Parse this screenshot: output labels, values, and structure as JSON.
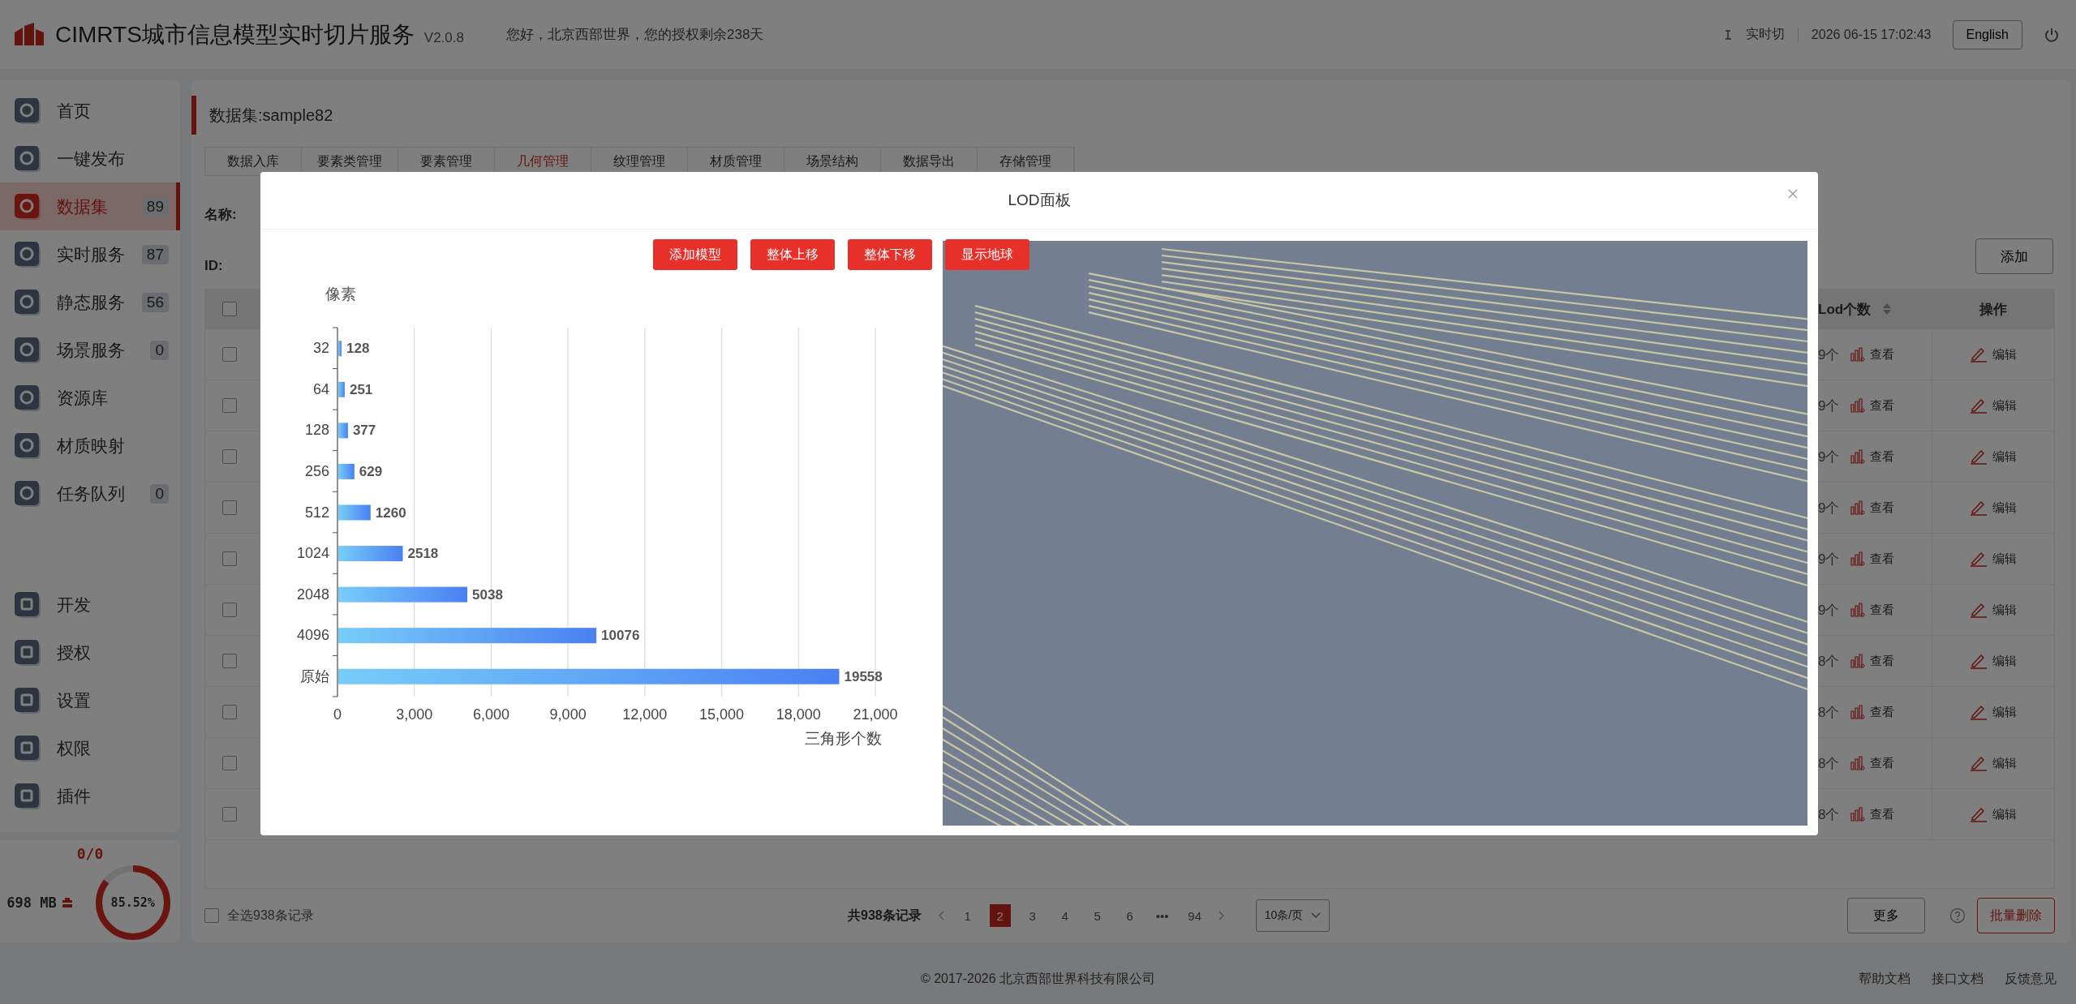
{
  "header": {
    "title": "CIMRTS城市信息模型实时切片服务",
    "version": "V2.0.8",
    "greeting": "您好，北京西部世界，您的授权剩余238天",
    "mode_label": "实时切",
    "datetime": "2026 06-15 17:02:43",
    "language_button": "English"
  },
  "sidebar": {
    "main_items": [
      {
        "label": "首页",
        "selected": false
      },
      {
        "label": "一键发布",
        "selected": false
      },
      {
        "label": "数据集",
        "badge": "89",
        "selected": true
      },
      {
        "label": "实时服务",
        "badge": "87",
        "selected": false
      },
      {
        "label": "静态服务",
        "badge": "56",
        "selected": false
      },
      {
        "label": "场景服务",
        "badge": "0",
        "selected": false
      },
      {
        "label": "资源库",
        "selected": false
      },
      {
        "label": "材质映射",
        "selected": false
      },
      {
        "label": "任务队列",
        "badge": "0",
        "selected": false
      }
    ],
    "system_items": [
      {
        "label": "开发",
        "selected": false
      },
      {
        "label": "授权",
        "selected": false
      },
      {
        "label": "设置",
        "selected": false
      },
      {
        "label": "权限",
        "selected": false
      },
      {
        "label": "插件",
        "selected": false
      }
    ]
  },
  "storage": {
    "ratio": "0/0",
    "size": "698 MB",
    "usage": "85.52%",
    "level": 0.8552
  },
  "dataset_title": "数据集:sample82",
  "tabs": [
    {
      "label": "数据入库",
      "selected": false
    },
    {
      "label": "要素类管理",
      "selected": false
    },
    {
      "label": "要素管理",
      "selected": false
    },
    {
      "label": "几何管理",
      "selected": true
    },
    {
      "label": "纹理管理",
      "selected": false
    },
    {
      "label": "材质管理",
      "selected": false
    },
    {
      "label": "场景结构",
      "selected": false
    },
    {
      "label": "数据导出",
      "selected": false
    },
    {
      "label": "存储管理",
      "selected": false
    }
  ],
  "filters": [
    "名称:",
    "ID:"
  ],
  "add_button": "添加",
  "table": {
    "columns": [
      "Lod个数",
      "操作"
    ],
    "header_checked": false,
    "rows": [
      {
        "lod": "9个",
        "view": "查看",
        "edit": "编辑",
        "checked": false
      },
      {
        "lod": "9个",
        "view": "查看",
        "edit": "编辑",
        "checked": false
      },
      {
        "lod": "9个",
        "view": "查看",
        "edit": "编辑",
        "checked": false
      },
      {
        "lod": "9个",
        "view": "查看",
        "edit": "编辑",
        "checked": false
      },
      {
        "lod": "9个",
        "view": "查看",
        "edit": "编辑",
        "checked": false
      },
      {
        "lod": "9个",
        "view": "查看",
        "edit": "编辑",
        "checked": false
      },
      {
        "lod": "8个",
        "view": "查看",
        "edit": "编辑",
        "checked": false
      },
      {
        "lod": "8个",
        "view": "查看",
        "edit": "编辑",
        "checked": false
      },
      {
        "lod": "8个",
        "view": "查看",
        "edit": "编辑",
        "checked": false
      },
      {
        "lod": "8个",
        "view": "查看",
        "edit": "编辑",
        "checked": false
      }
    ]
  },
  "pager": {
    "select_all": "全选938条记录",
    "select_all_checked": false,
    "total": "共938条记录",
    "pages": [
      {
        "label": "1",
        "selected": false
      },
      {
        "label": "2",
        "selected": true
      },
      {
        "label": "3",
        "selected": false
      },
      {
        "label": "4",
        "selected": false
      },
      {
        "label": "5",
        "selected": false
      },
      {
        "label": "6",
        "selected": false
      },
      {
        "label": "•••",
        "selected": false
      },
      {
        "label": "94",
        "selected": false
      }
    ],
    "page_size": "10条/页",
    "more_button": "更多",
    "delete_button": "批量删除"
  },
  "modal": {
    "title": "LOD面板",
    "buttons": [
      "添加模型",
      "整体上移",
      "整体下移",
      "显示地球"
    ],
    "chart_data": {
      "type": "bar",
      "orientation": "horizontal",
      "ylabel": "像素",
      "xlabel": "三角形个数",
      "categories": [
        "32",
        "64",
        "128",
        "256",
        "512",
        "1024",
        "2048",
        "4096",
        "原始"
      ],
      "values": [
        128,
        251,
        377,
        629,
        1260,
        2518,
        5038,
        10076,
        19558
      ],
      "xlim": [
        0,
        21000
      ],
      "xticks": [
        {
          "value": 0,
          "label": "0"
        },
        {
          "value": 3000,
          "label": "3,000"
        },
        {
          "value": 6000,
          "label": "6,000"
        },
        {
          "value": 9000,
          "label": "9,000"
        },
        {
          "value": 12000,
          "label": "12,000"
        },
        {
          "value": 15000,
          "label": "15,000"
        },
        {
          "value": 18000,
          "label": "18,000"
        },
        {
          "value": 21000,
          "label": "21,000"
        }
      ],
      "data_labels": true,
      "grid": true
    }
  },
  "footer": {
    "copyright": "© 2017-2026 北京西部世界科技有限公司",
    "links": [
      "帮助文档",
      "接口文档",
      "反馈意见"
    ]
  }
}
